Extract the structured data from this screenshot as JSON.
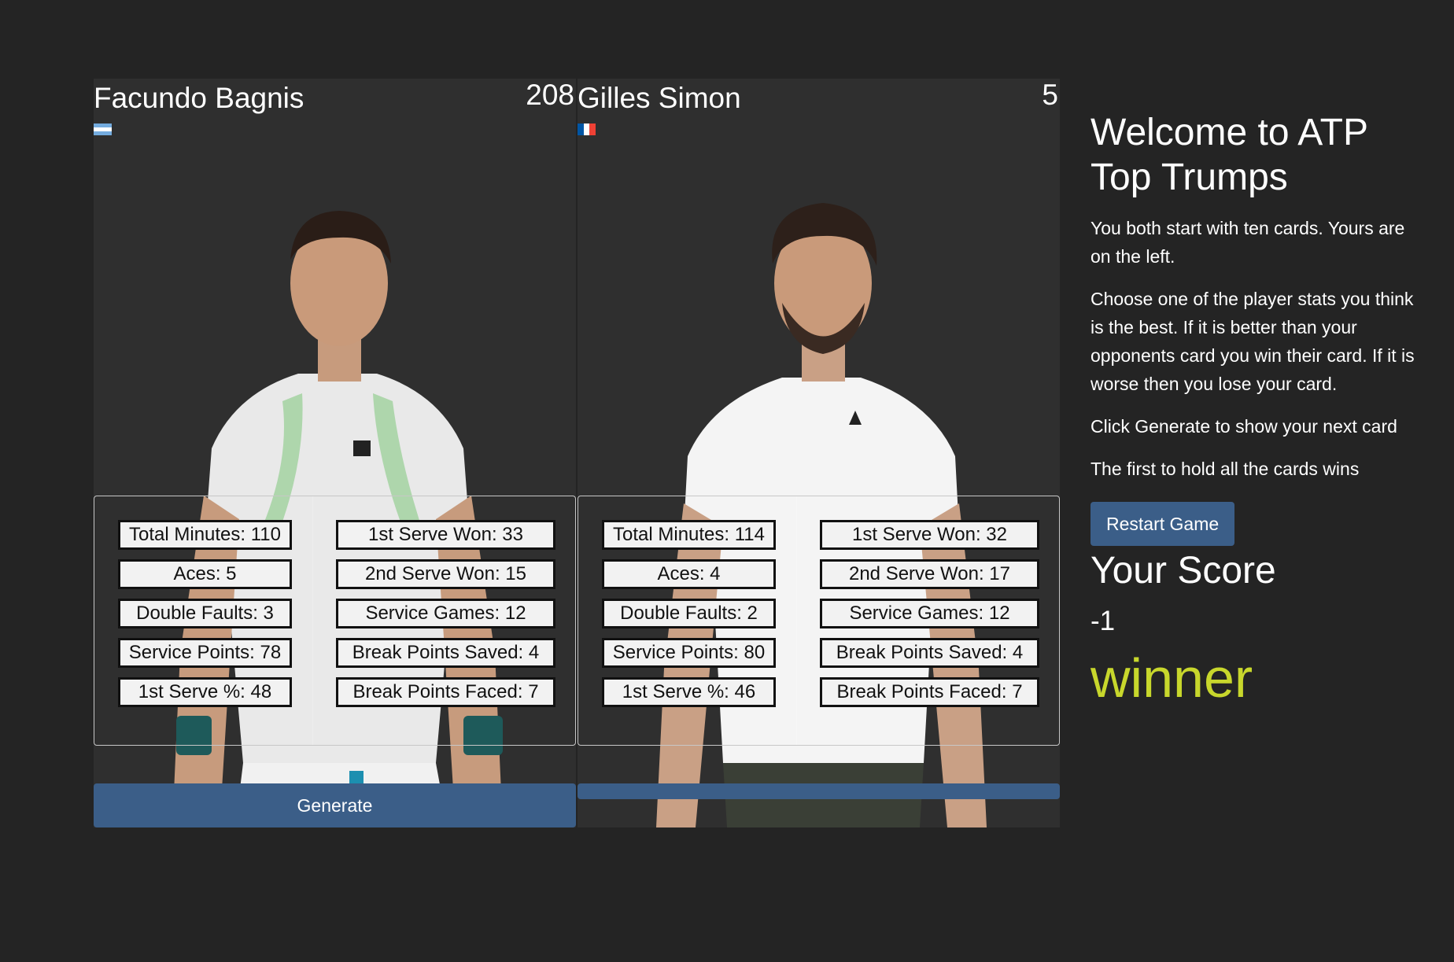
{
  "player_card": {
    "name": "Facundo Bagnis",
    "rank": "208",
    "flag_icon": "argentina-flag-icon",
    "stats_left": [
      "Total Minutes: 110",
      "Aces: 5",
      "Double Faults: 3",
      "Service Points: 78",
      "1st Serve %: 48"
    ],
    "stats_right": [
      "1st Serve Won: 33",
      "2nd Serve Won: 15",
      "Service Games: 12",
      "Break Points Saved: 4",
      "Break Points Faced: 7"
    ],
    "generate_label": "Generate"
  },
  "opponent_card": {
    "name": "Gilles Simon",
    "rank": "5",
    "flag_icon": "france-flag-icon",
    "stats_left": [
      "Total Minutes: 114",
      "Aces: 4",
      "Double Faults: 2",
      "Service Points: 80",
      "1st Serve %: 46"
    ],
    "stats_right": [
      "1st Serve Won: 32",
      "2nd Serve Won: 17",
      "Service Games: 12",
      "Break Points Saved: 4",
      "Break Points Faced: 7"
    ]
  },
  "sidebar": {
    "title": "Welcome to ATP Top Trumps",
    "paragraphs": [
      "You both start with ten cards. Yours are on the left.",
      "Choose one of the player stats you think is the best. If it is better than your opponents card you win their card. If it is worse then you lose your card.",
      "Click Generate to show your next card",
      "The first to hold all the cards wins"
    ],
    "restart_label": "Restart Game",
    "score_heading": "Your Score",
    "score_value": "-1",
    "result_text": "winner"
  },
  "colors": {
    "background": "#242424",
    "card": "#2f2f2f",
    "button": "#3b5e88",
    "result": "#c8d72c"
  }
}
